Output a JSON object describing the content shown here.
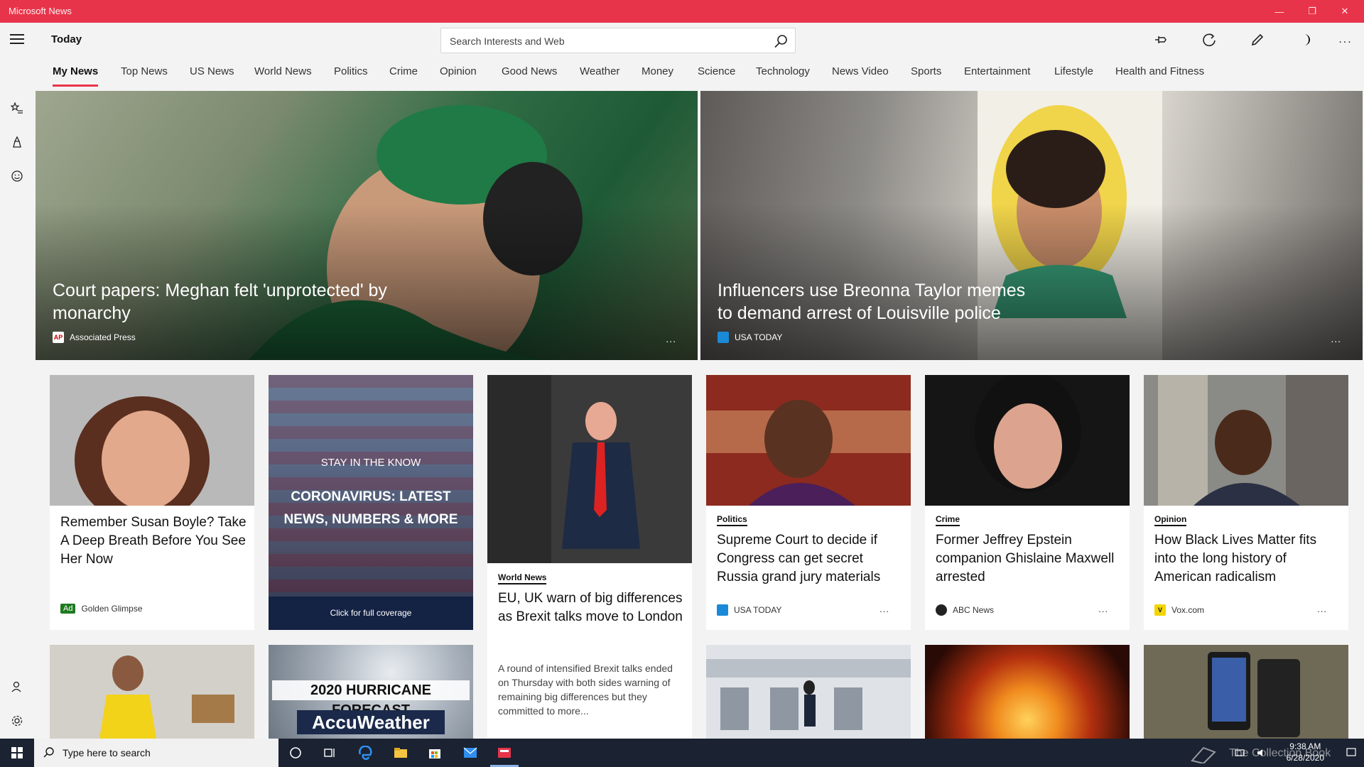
{
  "window": {
    "title": "Microsoft News",
    "controls": [
      "—",
      "❐",
      "✕"
    ]
  },
  "topbar": {
    "page_title": "Today",
    "search_placeholder": "Search Interests and Web",
    "tools": [
      "pin-icon",
      "refresh-icon",
      "edit-icon",
      "dark-mode-icon",
      "more-icon"
    ]
  },
  "tabs": [
    "My News",
    "Top News",
    "US News",
    "World News",
    "Politics",
    "Crime",
    "Opinion",
    "Good News",
    "Weather",
    "Money",
    "Science",
    "Technology",
    "News Video",
    "Sports",
    "Entertainment",
    "Lifestyle",
    "Health and Fitness"
  ],
  "active_tab": "My News",
  "hero": [
    {
      "headline": "Court papers: Meghan felt 'unprotected' by monarchy",
      "source": "Associated Press",
      "source_logo": "AP"
    },
    {
      "headline": "Influencers use Breonna Taylor memes to demand arrest of Louisville police",
      "source": "USA TODAY",
      "source_logo": ""
    }
  ],
  "cards": [
    {
      "title": "Remember Susan Boyle? Take A Deep Breath Before You See Her Now",
      "badge": "Ad",
      "source": "Golden Glimpse"
    },
    {
      "kicker": "STAY IN THE KNOW",
      "title": "CORONAVIRUS: LATEST NEWS, NUMBERS & MORE",
      "cta": "Click for full coverage"
    },
    {
      "category": "World News",
      "title": "EU, UK warn of big differences as Brexit talks move to London",
      "description": "A round of intensified Brexit talks ended on Thursday with both sides warning of remaining big differences but they committed to more..."
    },
    {
      "category": "Politics",
      "title": "Supreme Court to decide if Congress can get secret Russia grand jury materials",
      "source": "USA TODAY"
    },
    {
      "category": "Crime",
      "title": "Former Jeffrey Epstein companion Ghislaine Maxwell arrested",
      "source": "ABC News"
    },
    {
      "category": "Opinion",
      "title": "How Black Lives Matter fits into the long history of American radicalism",
      "source": "Vox.com",
      "source_logo": "V"
    }
  ],
  "row2": {
    "hurricane_title": "2020 HURRICANE FORECAST",
    "hurricane_brand": "AccuWeather"
  },
  "more_label": "...",
  "taskbar": {
    "search_placeholder": "Type here to search",
    "time": "9:38 AM",
    "date": "6/28/2020",
    "watermark": "The Collection Book"
  },
  "colors": {
    "accent": "#e8344a",
    "taskbar": "#1b2231"
  }
}
